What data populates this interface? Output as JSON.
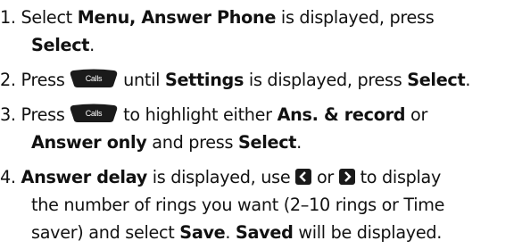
{
  "steps": [
    {
      "num": "1.",
      "l1_a": " Select ",
      "l1_b": "Menu, Answer Phone",
      "l1_c": " is displayed, press",
      "l2_a": "Select",
      "l2_b": "."
    },
    {
      "num": "2.",
      "a": " Press ",
      "b": " until ",
      "c": "Settings",
      "d": " is displayed, press ",
      "e": "Select",
      "f": "."
    },
    {
      "num": "3.",
      "l1_a": " Press ",
      "l1_b": " to highlight either ",
      "l1_c": "Ans. & record",
      "l1_d": " or",
      "l2_a": "Answer only",
      "l2_b": " and press ",
      "l2_c": "Select",
      "l2_d": "."
    },
    {
      "num": "4.",
      "l1_a": "Answer delay",
      "l1_b": " is displayed, use ",
      "l1_c": " or ",
      "l1_d": " to display",
      "l2": "the number of rings you want (2–10 rings or Time",
      "l3_a": "saver) and select ",
      "l3_b": "Save",
      "l3_c": ". ",
      "l3_d": "Saved",
      "l3_e": " will be displayed."
    }
  ],
  "calls_key_label": "Calls",
  "colors": {
    "key_fill": "#1a1a1a",
    "key_text": "#ffffff",
    "text": "#111111"
  },
  "icons": {
    "calls_key": "calls-key-icon",
    "left": "left-arrow-key-icon",
    "right": "right-arrow-key-icon"
  }
}
